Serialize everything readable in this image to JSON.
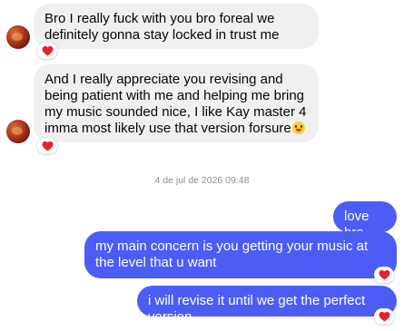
{
  "colors": {
    "incoming_bg": "#f0f0f0",
    "outgoing_bg": "#4c5df6",
    "reaction_heart": "#e8202c"
  },
  "messages": [
    {
      "direction": "incoming",
      "text": "Bro I really fuck with you bro foreal we definitely gonna stay locked in trust me",
      "reaction": "heart-icon"
    },
    {
      "direction": "incoming",
      "text": "And I really appreciate you revising and being patient with me and helping me bring my music sounded nice, I like Kay master 4 imma most likely use that version forsure",
      "emoji": "grinning-face-with-tongue-icon",
      "reaction": "heart-icon"
    }
  ],
  "timestamp": "4 de jul de 2026 09:48",
  "outgoing": [
    {
      "text": "love bro"
    },
    {
      "text": "my main concern is you getting your music at the level that u want",
      "reaction": "heart-icon"
    },
    {
      "text": "i will revise it until we get the perfect version",
      "reaction": "heart-icon"
    }
  ]
}
